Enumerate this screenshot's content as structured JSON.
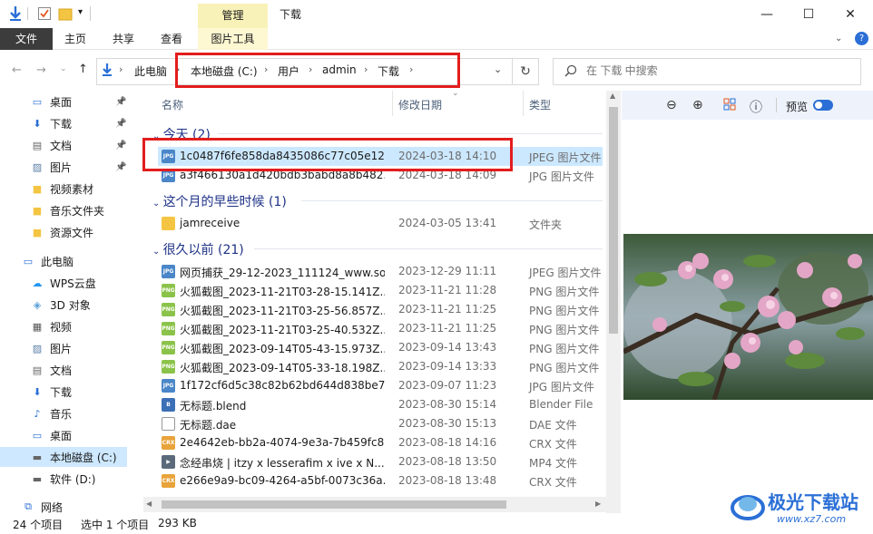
{
  "titlebar": {
    "context_tab": "管理",
    "window_title": "下载",
    "minimize": "—",
    "maximize": "☐",
    "close": "✕"
  },
  "ribbon": {
    "tabs": [
      {
        "label": "文件"
      },
      {
        "label": "主页"
      },
      {
        "label": "共享"
      },
      {
        "label": "查看"
      },
      {
        "label": "图片工具"
      }
    ]
  },
  "address": {
    "crumbs": [
      "此电脑",
      "本地磁盘 (C:)",
      "用户",
      "admin",
      "下载"
    ],
    "search_placeholder": "在 下载 中搜索"
  },
  "sidebar": {
    "items": [
      {
        "label": "桌面",
        "icon": "desktop-icon",
        "pinned": true
      },
      {
        "label": "下载",
        "icon": "download-icon",
        "pinned": true
      },
      {
        "label": "文档",
        "icon": "document-icon",
        "pinned": true
      },
      {
        "label": "图片",
        "icon": "picture-icon",
        "pinned": true
      },
      {
        "label": "视频素材",
        "icon": "folder-icon",
        "pinned": false
      },
      {
        "label": "音乐文件夹",
        "icon": "folder-icon",
        "pinned": false
      },
      {
        "label": "资源文件",
        "icon": "folder-icon",
        "pinned": false
      },
      {
        "label": "此电脑",
        "icon": "computer-icon",
        "pinned": false
      },
      {
        "label": "WPS云盘",
        "icon": "cloud-icon",
        "pinned": false
      },
      {
        "label": "3D 对象",
        "icon": "cube-icon",
        "pinned": false
      },
      {
        "label": "视频",
        "icon": "video-icon",
        "pinned": false
      },
      {
        "label": "图片",
        "icon": "picture-icon",
        "pinned": false
      },
      {
        "label": "文档",
        "icon": "document-icon",
        "pinned": false
      },
      {
        "label": "下载",
        "icon": "download-icon",
        "pinned": false
      },
      {
        "label": "音乐",
        "icon": "music-icon",
        "pinned": false
      },
      {
        "label": "桌面",
        "icon": "desktop-icon",
        "pinned": false
      },
      {
        "label": "本地磁盘 (C:)",
        "icon": "drive-icon",
        "pinned": false
      },
      {
        "label": "软件 (D:)",
        "icon": "drive-icon",
        "pinned": false
      },
      {
        "label": "网络",
        "icon": "network-icon",
        "pinned": false
      }
    ]
  },
  "columns": {
    "name": "名称",
    "date": "修改日期",
    "type": "类型"
  },
  "groups": [
    {
      "title": "今天 (2)"
    },
    {
      "title": "这个月的早些时候 (1)"
    },
    {
      "title": "很久以前 (21)"
    }
  ],
  "files": [
    {
      "name": "1c0487f6fe858da8435086c77c05e125...",
      "date": "2024-03-18 14:10",
      "type": "JPEG 图片文件",
      "icon": "jpeg-icon"
    },
    {
      "name": "a3f466130a1d420bdb3babd8a8b482...",
      "date": "2024-03-18 14:09",
      "type": "JPG 图片文件",
      "icon": "jpeg-icon"
    },
    {
      "name": "jamreceive",
      "date": "2024-03-05 13:41",
      "type": "文件夹",
      "icon": "folder-icon"
    },
    {
      "name": "网页捕获_29-12-2023_111124_www.so...",
      "date": "2023-12-29 11:11",
      "type": "JPEG 图片文件",
      "icon": "jpeg-icon"
    },
    {
      "name": "火狐截图_2023-11-21T03-28-15.141Z...",
      "date": "2023-11-21 11:28",
      "type": "PNG 图片文件",
      "icon": "png-icon"
    },
    {
      "name": "火狐截图_2023-11-21T03-25-56.857Z...",
      "date": "2023-11-21 11:25",
      "type": "PNG 图片文件",
      "icon": "png-icon"
    },
    {
      "name": "火狐截图_2023-11-21T03-25-40.532Z...",
      "date": "2023-11-21 11:25",
      "type": "PNG 图片文件",
      "icon": "png-icon"
    },
    {
      "name": "火狐截图_2023-09-14T05-43-15.973Z...",
      "date": "2023-09-14 13:43",
      "type": "PNG 图片文件",
      "icon": "png-icon"
    },
    {
      "name": "火狐截图_2023-09-14T05-33-18.198Z...",
      "date": "2023-09-14 13:33",
      "type": "PNG 图片文件",
      "icon": "png-icon"
    },
    {
      "name": "1f172cf6d5c38c82b62bd644d838be7...",
      "date": "2023-09-07 11:23",
      "type": "JPG 图片文件",
      "icon": "jpeg-icon"
    },
    {
      "name": "无标题.blend",
      "date": "2023-08-30 15:14",
      "type": "Blender File",
      "icon": "blend-icon"
    },
    {
      "name": "无标题.dae",
      "date": "2023-08-30 15:13",
      "type": "DAE 文件",
      "icon": "file-icon"
    },
    {
      "name": "2e4642eb-bb2a-4074-9e3a-7b459fc8...",
      "date": "2023-08-18 14:16",
      "type": "CRX 文件",
      "icon": "crx-icon"
    },
    {
      "name": "念经串烧 | itzy x lesserafim x ive x N...",
      "date": "2023-08-18 13:50",
      "type": "MP4 文件",
      "icon": "video-icon"
    },
    {
      "name": "e266e9a9-bc09-4264-a5bf-0073c36a...",
      "date": "2023-08-18 13:48",
      "type": "CRX 文件",
      "icon": "crx-icon"
    }
  ],
  "preview": {
    "label": "预览"
  },
  "status": {
    "count": "24 个项目",
    "selected": "选中 1 个项目",
    "size": "293 KB"
  },
  "watermark": {
    "text": "极光下载站",
    "url": "www.xz7.com"
  },
  "colors": {
    "selection": "#cce8ff",
    "accent": "#1e3287",
    "highlight": "#e31d1d"
  }
}
